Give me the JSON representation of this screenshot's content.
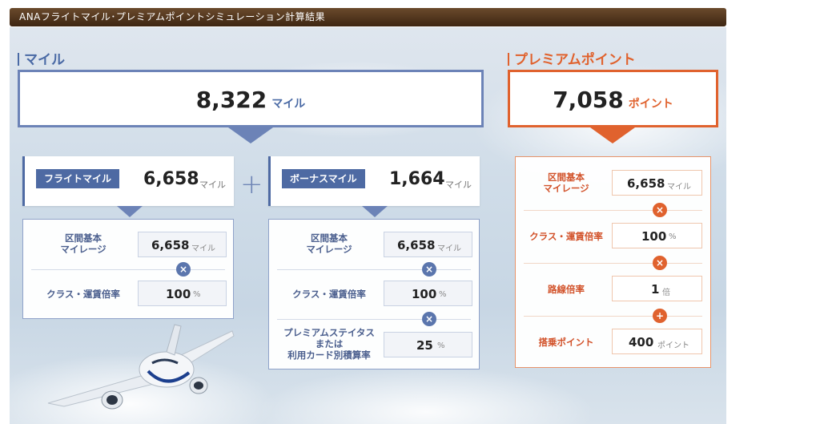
{
  "title": "ANAフライトマイル･プレミアムポイントシミュレーション計算結果",
  "miles": {
    "label": "マイル",
    "total": "8,322",
    "unit": "マイル",
    "flight": {
      "tag": "フライトマイル",
      "value": "6,658",
      "unit": "マイル",
      "rows": [
        {
          "label": "区間基本\nマイレージ",
          "value": "6,658",
          "unit": "マイル"
        },
        {
          "label": "クラス・運賃倍率",
          "value": "100",
          "unit": "%"
        }
      ]
    },
    "plus": "+",
    "bonus": {
      "tag": "ボーナスマイル",
      "value": "1,664",
      "unit": "マイル",
      "rows": [
        {
          "label": "区間基本\nマイレージ",
          "value": "6,658",
          "unit": "マイル"
        },
        {
          "label": "クラス・運賃倍率",
          "value": "100",
          "unit": "%"
        },
        {
          "label": "プレミアムステイタス\nまたは\n利用カード別積算率",
          "value": "25",
          "unit": "%"
        }
      ]
    }
  },
  "premium": {
    "label": "プレミアムポイント",
    "total": "7,058",
    "unit": "ポイント",
    "rows": [
      {
        "label": "区間基本\nマイレージ",
        "value": "6,658",
        "unit": "マイル"
      },
      {
        "label": "クラス・運賃倍率",
        "value": "100",
        "unit": "%"
      },
      {
        "label": "路線倍率",
        "value": "1",
        "unit": "倍"
      },
      {
        "label": "搭乗ポイント",
        "value": "400",
        "unit": "ポイント"
      }
    ]
  },
  "ops": {
    "times": "×",
    "plus": "+"
  },
  "colors": {
    "blue": "#4a6aa5",
    "orange": "#e0622e",
    "titlebar": "#4a3019"
  }
}
